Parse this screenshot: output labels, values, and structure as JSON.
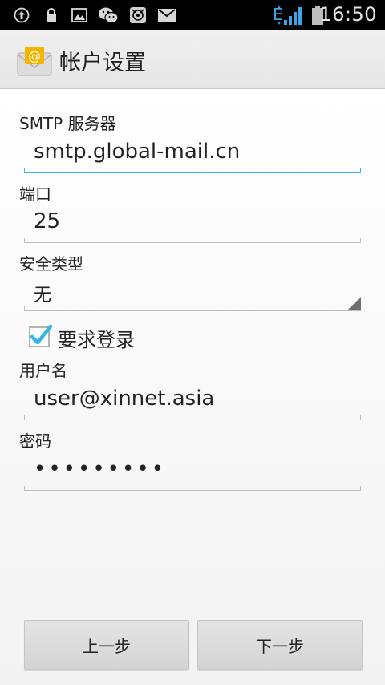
{
  "status_bar": {
    "time": "16:50",
    "network_type": "E",
    "icons": [
      "upload-icon",
      "lock-icon",
      "image-icon",
      "wechat-icon",
      "app-icon",
      "mail-icon",
      "signal-icon",
      "battery-icon"
    ]
  },
  "header": {
    "title": "帐户设置",
    "icon": "email-app-icon"
  },
  "form": {
    "smtp_server": {
      "label": "SMTP 服务器",
      "value": "smtp.global-mail.cn"
    },
    "port": {
      "label": "端口",
      "value": "25"
    },
    "security_type": {
      "label": "安全类型",
      "value": "无"
    },
    "require_login": {
      "label": "要求登录",
      "checked": true
    },
    "username": {
      "label": "用户名",
      "value": "user@xinnet.asia"
    },
    "password": {
      "label": "密码",
      "value": "•••••••••"
    }
  },
  "buttons": {
    "previous": "上一步",
    "next": "下一步"
  },
  "colors": {
    "focus_accent": "#33b5e5",
    "checkbox_accent": "#33b5e5",
    "status_bar_bg": "#000000",
    "signal_blue": "#3aa6e8"
  }
}
